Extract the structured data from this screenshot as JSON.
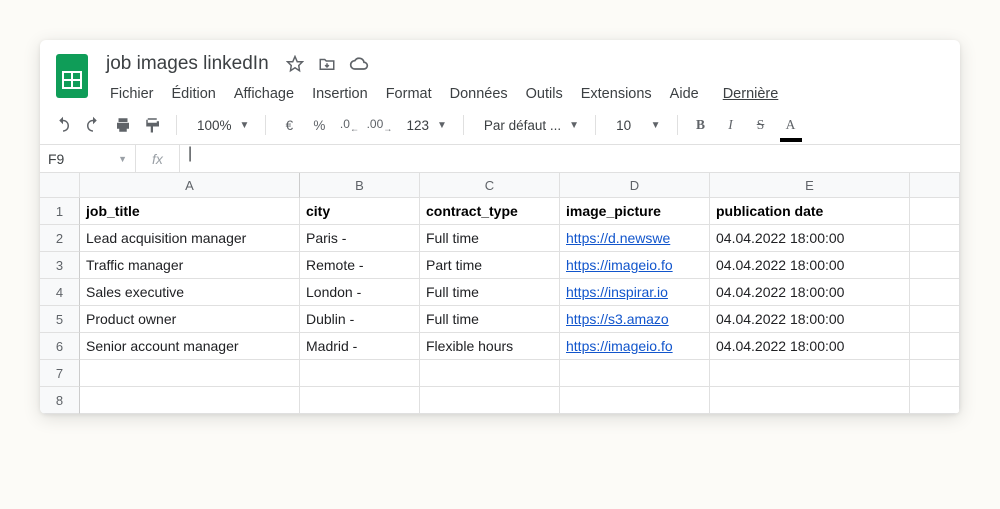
{
  "doc": {
    "title": "job images linkedIn"
  },
  "menubar": {
    "file": "Fichier",
    "edit": "Édition",
    "view": "Affichage",
    "insert": "Insertion",
    "format": "Format",
    "data": "Données",
    "tools": "Outils",
    "extensions": "Extensions",
    "help": "Aide",
    "last": "Dernière"
  },
  "toolbar": {
    "zoom": "100%",
    "currency": "€",
    "percent": "%",
    "dec_decrease": ".0",
    "dec_increase": ".00",
    "num_fmt": "123",
    "font": "Par défaut ...",
    "font_size": "10",
    "bold_glyph": "B",
    "italic_glyph": "I",
    "strike_glyph": "S",
    "textcolor_glyph": "A"
  },
  "namebox": {
    "ref": "F9"
  },
  "fx": {
    "label": "fx"
  },
  "columns": {
    "A": "A",
    "B": "B",
    "C": "C",
    "D": "D",
    "E": "E"
  },
  "headers": {
    "A": "job_title",
    "B": "city",
    "C": "contract_type",
    "D": "image_picture",
    "E": "publication date"
  },
  "rows": [
    {
      "A": "Lead acquisition manager",
      "B": "Paris -",
      "C": " Full time",
      "D": "https://d.newswe",
      "E": "04.04.2022 18:00:00"
    },
    {
      "A": "Traffic manager",
      "B": "Remote -",
      "C": "Part time",
      "D": "https://imageio.fo",
      "E": "04.04.2022 18:00:00"
    },
    {
      "A": "Sales executive",
      "B": "London -",
      "C": "Full time",
      "D": "https://inspirar.io",
      "E": "04.04.2022 18:00:00"
    },
    {
      "A": "Product owner",
      "B": "Dublin -",
      "C": "Full time",
      "D": "https://s3.amazo",
      "E": "04.04.2022 18:00:00"
    },
    {
      "A": "Senior account manager",
      "B": "Madrid -",
      "C": "Flexible hours",
      "D": "https://imageio.fo",
      "E": "04.04.2022 18:00:00"
    }
  ],
  "row_numbers": [
    "1",
    "2",
    "3",
    "4",
    "5",
    "6",
    "7",
    "8"
  ]
}
